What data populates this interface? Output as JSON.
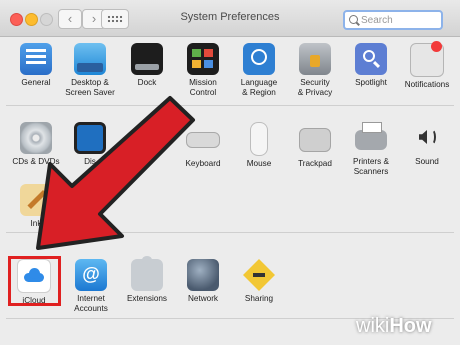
{
  "window": {
    "title": "System Preferences",
    "search_placeholder": "Search",
    "nav_back": "‹",
    "nav_forward": "›"
  },
  "sections": {
    "personal": [
      {
        "label": "General",
        "icon": "general-icon"
      },
      {
        "label": "Desktop &\nScreen Saver",
        "icon": "desktop-icon"
      },
      {
        "label": "Dock",
        "icon": "dock-icon"
      },
      {
        "label": "Mission\nControl",
        "icon": "mission-control-icon"
      },
      {
        "label": "Language\n& Region",
        "icon": "language-icon"
      },
      {
        "label": "Security\n& Privacy",
        "icon": "security-icon"
      },
      {
        "label": "Spotlight",
        "icon": "spotlight-icon"
      },
      {
        "label": "Notifications",
        "icon": "notifications-icon"
      }
    ],
    "hardware": [
      {
        "label": "CDs & DVDs",
        "icon": "cd-icon"
      },
      {
        "label": "Dis",
        "icon": "displays-icon"
      },
      {
        "label": "",
        "icon": "energy-icon"
      },
      {
        "label": "Keyboard",
        "icon": "keyboard-icon"
      },
      {
        "label": "Mouse",
        "icon": "mouse-icon"
      },
      {
        "label": "Trackpad",
        "icon": "trackpad-icon"
      },
      {
        "label": "Printers &\nScanners",
        "icon": "printer-icon"
      },
      {
        "label": "Sound",
        "icon": "speaker-icon"
      }
    ],
    "hardware_row2": [
      {
        "label": "Ink",
        "icon": "ink-icon"
      }
    ],
    "internet": [
      {
        "label": "iCloud",
        "icon": "icloud-icon"
      },
      {
        "label": "Internet\nAccounts",
        "icon": "at-icon"
      },
      {
        "label": "Extensions",
        "icon": "puzzle-icon"
      },
      {
        "label": "Network",
        "icon": "globe-icon"
      },
      {
        "label": "Sharing",
        "icon": "sharing-icon"
      }
    ]
  },
  "watermark": {
    "wiki": "wiki",
    "how": "How"
  },
  "colors": {
    "annotation_red": "#e02020",
    "search_focus": "#8db3ea"
  }
}
